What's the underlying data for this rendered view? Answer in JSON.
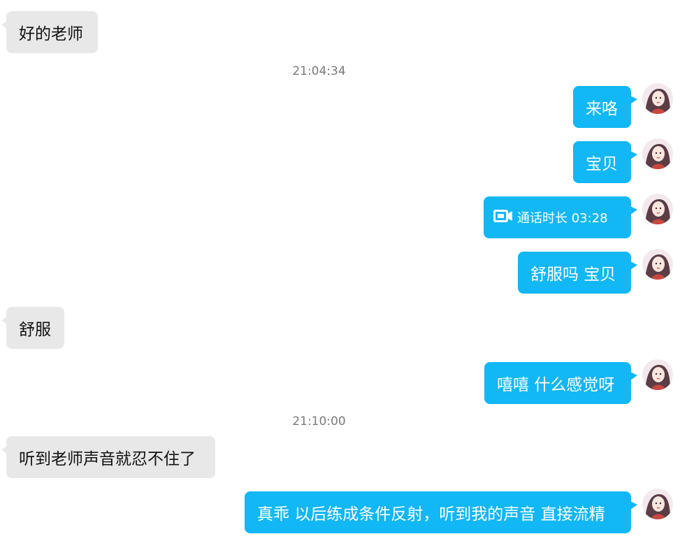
{
  "messages": [
    {
      "kind": "in",
      "text": "好的老师"
    },
    {
      "kind": "time",
      "text": "21:04:34"
    },
    {
      "kind": "out",
      "text": "来咯"
    },
    {
      "kind": "out",
      "text": "宝贝"
    },
    {
      "kind": "call",
      "icon": "video-camera-icon",
      "text": "通话时长 03:28"
    },
    {
      "kind": "out",
      "text": "舒服吗 宝贝"
    },
    {
      "kind": "in",
      "text": "舒服"
    },
    {
      "kind": "out",
      "text": "嘻嘻 什么感觉呀"
    },
    {
      "kind": "time",
      "text": "21:10:00"
    },
    {
      "kind": "in",
      "text": "听到老师声音就忍不住了"
    },
    {
      "kind": "out",
      "text": "真乖 以后练成条件反射，听到我的声音 直接流精"
    }
  ],
  "colors": {
    "outgoing_bubble": "#12b7f5",
    "incoming_bubble": "#e8e8e8",
    "timestamp_text": "#7a7a7a"
  }
}
